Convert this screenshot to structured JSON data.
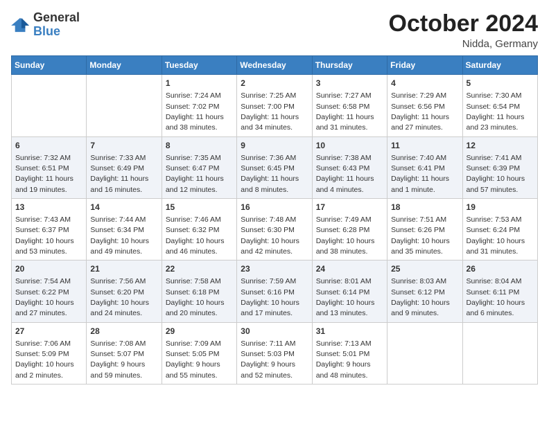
{
  "header": {
    "logo_general": "General",
    "logo_blue": "Blue",
    "month_title": "October 2024",
    "subtitle": "Nidda, Germany"
  },
  "days_of_week": [
    "Sunday",
    "Monday",
    "Tuesday",
    "Wednesday",
    "Thursday",
    "Friday",
    "Saturday"
  ],
  "weeks": [
    [
      {
        "day": "",
        "info": ""
      },
      {
        "day": "",
        "info": ""
      },
      {
        "day": "1",
        "info": "Sunrise: 7:24 AM\nSunset: 7:02 PM\nDaylight: 11 hours and 38 minutes."
      },
      {
        "day": "2",
        "info": "Sunrise: 7:25 AM\nSunset: 7:00 PM\nDaylight: 11 hours and 34 minutes."
      },
      {
        "day": "3",
        "info": "Sunrise: 7:27 AM\nSunset: 6:58 PM\nDaylight: 11 hours and 31 minutes."
      },
      {
        "day": "4",
        "info": "Sunrise: 7:29 AM\nSunset: 6:56 PM\nDaylight: 11 hours and 27 minutes."
      },
      {
        "day": "5",
        "info": "Sunrise: 7:30 AM\nSunset: 6:54 PM\nDaylight: 11 hours and 23 minutes."
      }
    ],
    [
      {
        "day": "6",
        "info": "Sunrise: 7:32 AM\nSunset: 6:51 PM\nDaylight: 11 hours and 19 minutes."
      },
      {
        "day": "7",
        "info": "Sunrise: 7:33 AM\nSunset: 6:49 PM\nDaylight: 11 hours and 16 minutes."
      },
      {
        "day": "8",
        "info": "Sunrise: 7:35 AM\nSunset: 6:47 PM\nDaylight: 11 hours and 12 minutes."
      },
      {
        "day": "9",
        "info": "Sunrise: 7:36 AM\nSunset: 6:45 PM\nDaylight: 11 hours and 8 minutes."
      },
      {
        "day": "10",
        "info": "Sunrise: 7:38 AM\nSunset: 6:43 PM\nDaylight: 11 hours and 4 minutes."
      },
      {
        "day": "11",
        "info": "Sunrise: 7:40 AM\nSunset: 6:41 PM\nDaylight: 11 hours and 1 minute."
      },
      {
        "day": "12",
        "info": "Sunrise: 7:41 AM\nSunset: 6:39 PM\nDaylight: 10 hours and 57 minutes."
      }
    ],
    [
      {
        "day": "13",
        "info": "Sunrise: 7:43 AM\nSunset: 6:37 PM\nDaylight: 10 hours and 53 minutes."
      },
      {
        "day": "14",
        "info": "Sunrise: 7:44 AM\nSunset: 6:34 PM\nDaylight: 10 hours and 49 minutes."
      },
      {
        "day": "15",
        "info": "Sunrise: 7:46 AM\nSunset: 6:32 PM\nDaylight: 10 hours and 46 minutes."
      },
      {
        "day": "16",
        "info": "Sunrise: 7:48 AM\nSunset: 6:30 PM\nDaylight: 10 hours and 42 minutes."
      },
      {
        "day": "17",
        "info": "Sunrise: 7:49 AM\nSunset: 6:28 PM\nDaylight: 10 hours and 38 minutes."
      },
      {
        "day": "18",
        "info": "Sunrise: 7:51 AM\nSunset: 6:26 PM\nDaylight: 10 hours and 35 minutes."
      },
      {
        "day": "19",
        "info": "Sunrise: 7:53 AM\nSunset: 6:24 PM\nDaylight: 10 hours and 31 minutes."
      }
    ],
    [
      {
        "day": "20",
        "info": "Sunrise: 7:54 AM\nSunset: 6:22 PM\nDaylight: 10 hours and 27 minutes."
      },
      {
        "day": "21",
        "info": "Sunrise: 7:56 AM\nSunset: 6:20 PM\nDaylight: 10 hours and 24 minutes."
      },
      {
        "day": "22",
        "info": "Sunrise: 7:58 AM\nSunset: 6:18 PM\nDaylight: 10 hours and 20 minutes."
      },
      {
        "day": "23",
        "info": "Sunrise: 7:59 AM\nSunset: 6:16 PM\nDaylight: 10 hours and 17 minutes."
      },
      {
        "day": "24",
        "info": "Sunrise: 8:01 AM\nSunset: 6:14 PM\nDaylight: 10 hours and 13 minutes."
      },
      {
        "day": "25",
        "info": "Sunrise: 8:03 AM\nSunset: 6:12 PM\nDaylight: 10 hours and 9 minutes."
      },
      {
        "day": "26",
        "info": "Sunrise: 8:04 AM\nSunset: 6:11 PM\nDaylight: 10 hours and 6 minutes."
      }
    ],
    [
      {
        "day": "27",
        "info": "Sunrise: 7:06 AM\nSunset: 5:09 PM\nDaylight: 10 hours and 2 minutes."
      },
      {
        "day": "28",
        "info": "Sunrise: 7:08 AM\nSunset: 5:07 PM\nDaylight: 9 hours and 59 minutes."
      },
      {
        "day": "29",
        "info": "Sunrise: 7:09 AM\nSunset: 5:05 PM\nDaylight: 9 hours and 55 minutes."
      },
      {
        "day": "30",
        "info": "Sunrise: 7:11 AM\nSunset: 5:03 PM\nDaylight: 9 hours and 52 minutes."
      },
      {
        "day": "31",
        "info": "Sunrise: 7:13 AM\nSunset: 5:01 PM\nDaylight: 9 hours and 48 minutes."
      },
      {
        "day": "",
        "info": ""
      },
      {
        "day": "",
        "info": ""
      }
    ]
  ]
}
